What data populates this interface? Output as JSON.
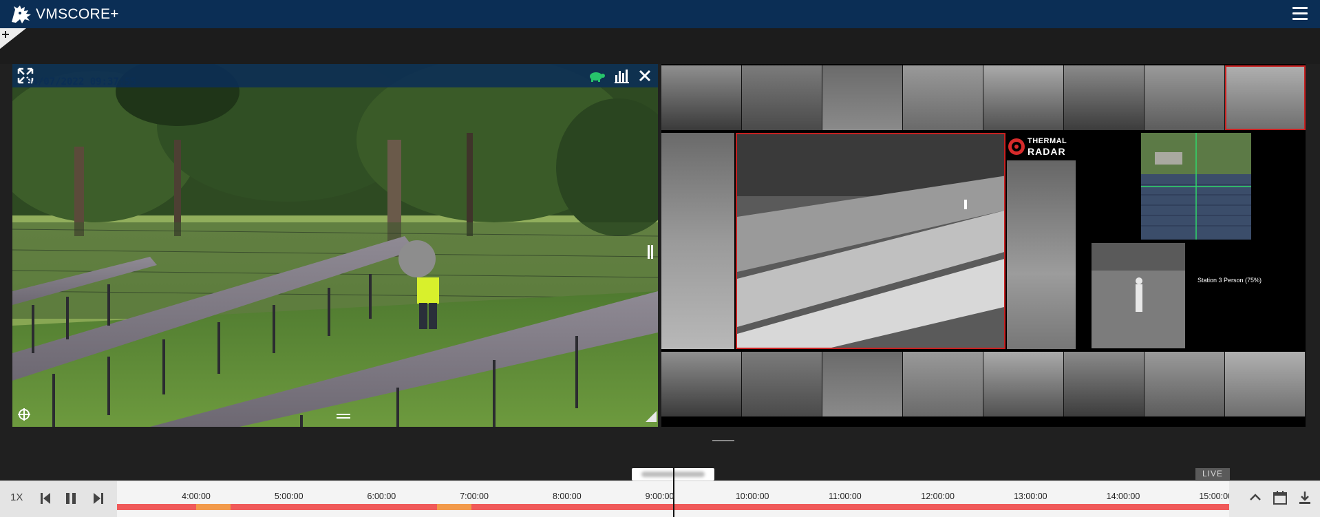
{
  "app": {
    "title": "VMSCORE+"
  },
  "colors": {
    "header": "#0b2e55",
    "alert_border": "#c82020",
    "timeline_events": "#f05a5a",
    "event_highlight": "#f29a4a",
    "tortoise": "#27c46b"
  },
  "icons": {
    "logo": "lion-crest-icon",
    "menu": "hamburger-menu-icon",
    "add": "plus-icon",
    "fullscreen": "fullscreen-icon",
    "slow": "tortoise-icon",
    "stats": "bar-chart-icon",
    "close": "close-icon",
    "ptz": "ptz-icon",
    "overlay": "overlay-menu-icon",
    "pause_overlay": "pause-icon",
    "resize": "resize-corner-icon",
    "step_back": "step-back-icon",
    "pause": "pause-icon",
    "step_forward": "step-forward-icon",
    "collapse": "chevron-up-icon",
    "calendar": "calendar-icon",
    "download": "download-icon"
  },
  "camera_left": {
    "timestamp": "04/07/2022 09:37:55"
  },
  "thermal_radar": {
    "brand_line1": "THERMAL",
    "brand_line2": "RADAR"
  },
  "detection": {
    "label": "Station 3 Person (75%)"
  },
  "timeline": {
    "speed": "1X",
    "live": "LIVE",
    "ticks": [
      "4:00:00",
      "5:00:00",
      "6:00:00",
      "7:00:00",
      "8:00:00",
      "9:00:00",
      "10:00:00",
      "11:00:00",
      "12:00:00",
      "13:00:00",
      "14:00:00",
      "15:00:00"
    ],
    "cursor_time": "9:00:00"
  }
}
